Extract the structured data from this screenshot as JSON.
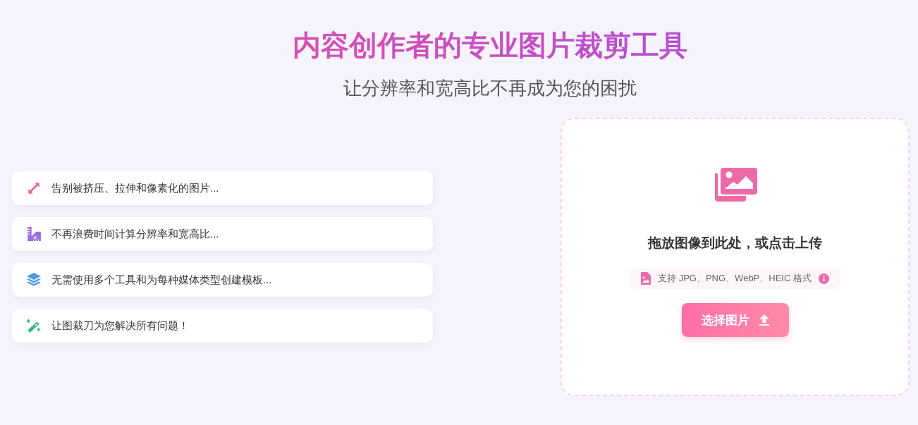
{
  "header": {
    "title": "内容创作者的专业图片裁剪工具",
    "subtitle": "让分辨率和宽高比不再成为您的困扰"
  },
  "features": [
    {
      "kind": "resize",
      "text": "告别被挤压、拉伸和像素化的图片..."
    },
    {
      "kind": "ruler",
      "text": "不再浪费时间计算分辨率和宽高比..."
    },
    {
      "kind": "layers",
      "text": "无需使用多个工具和为每种媒体类型创建模板..."
    },
    {
      "kind": "magic",
      "text": "让图裁刀为您解决所有问题！"
    }
  ],
  "upload": {
    "prompt": "拖放图像到此处，或点击上传",
    "formats": "支持 JPG、PNG、WebP、HEIC 格式",
    "button": "选择图片"
  }
}
